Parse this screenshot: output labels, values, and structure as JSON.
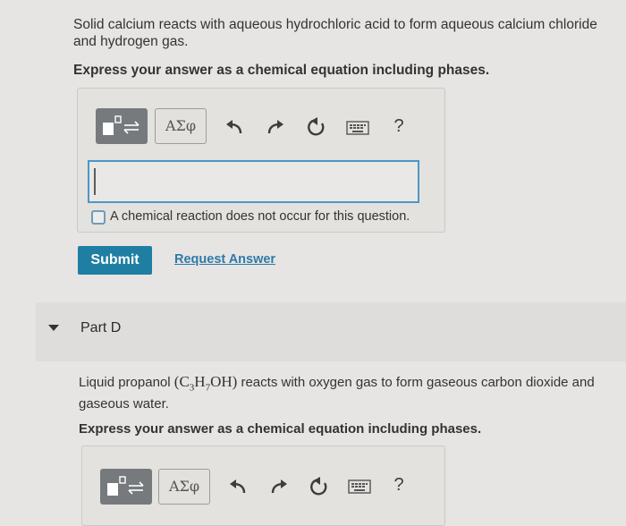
{
  "question": {
    "text_line1": "Solid calcium reacts with aqueous hydrochloric acid to form aqueous calcium chloride",
    "text_line2": "and hydrogen gas.",
    "instruction": "Express your answer as a chemical equation including phases."
  },
  "toolbar": {
    "greek_label": "ΑΣφ",
    "help_label": "?",
    "icons": [
      "templates-icon",
      "greek-letters-icon",
      "undo-icon",
      "redo-icon",
      "reset-icon",
      "keyboard-icon",
      "help-icon"
    ]
  },
  "answer": {
    "value": "",
    "no_reaction_label": "A chemical reaction does not occur for this question."
  },
  "actions": {
    "submit_label": "Submit",
    "request_label": "Request Answer"
  },
  "part_d": {
    "title": "Part D",
    "text_pre": "Liquid propanol",
    "formula_open": "(",
    "formula_c": "C",
    "formula_c_sub": "3",
    "formula_h": "H",
    "formula_h_sub": "7",
    "formula_oh": "OH",
    "formula_close": ")",
    "text_post": "reacts with oxygen gas to form gaseous carbon dioxide and",
    "text_line2": "gaseous water.",
    "instruction": "Express your answer as a chemical equation including phases."
  },
  "colors": {
    "accent": "#1e7fa3",
    "link": "#2f7aa7",
    "input_border": "#4e96c5",
    "background": "#e6e5e3"
  }
}
